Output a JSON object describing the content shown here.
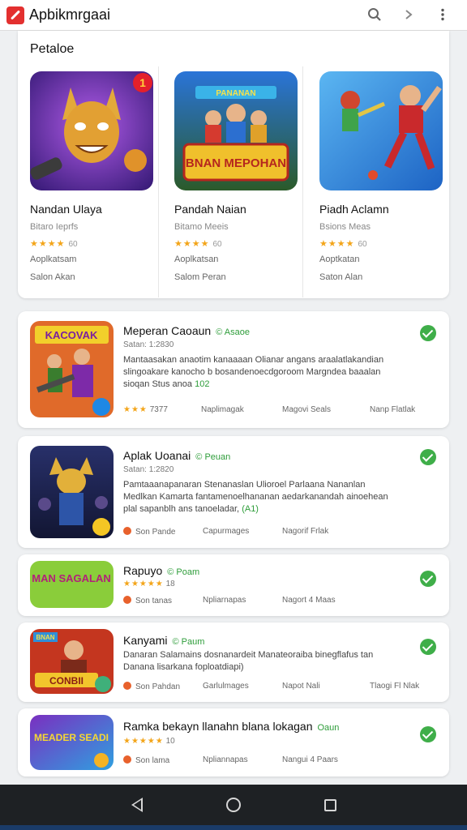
{
  "app": {
    "title": "Apbikmrgaai",
    "accent": "#e3302f",
    "icons": [
      "search-icon",
      "chevron-right-icon",
      "more-vert-icon"
    ]
  },
  "featured": {
    "title": "Petaloe",
    "cards": [
      {
        "name": "Nandan Ulaya",
        "subtitle": "Bitaro Ieprfs",
        "stars": "★★★★",
        "rating": "60",
        "meta1": "Aoplkatsam",
        "meta2": "Salon Akan",
        "badge": "1"
      },
      {
        "name": "Pandah Naian",
        "subtitle": "Bitamo Meeis",
        "stars": "★★★★",
        "rating": "60",
        "meta1": "Aoplkatsan",
        "meta2": "Salom Peran",
        "banner": "BNAN MEPOHAN",
        "topline": "PANANAN"
      },
      {
        "name": "Piadh Aclamn",
        "subtitle": "Bsions Meas",
        "stars": "★★★★",
        "rating": "60",
        "meta1": "Aoptkatan",
        "meta2": "Saton Alan"
      }
    ]
  },
  "list": [
    {
      "title": "Meperan Caoaun",
      "tag": "© Asaoe",
      "subtitle": "Satan: 1:2830",
      "desc": "Mantaasakan anaotim kanaaaan Olianar angans araalatlakandian slingoakare kanocho b bosandenoecdgoroom Margndea baaalan sioqan Stus anoa",
      "desc_hl": "102",
      "stars": "★★★",
      "rating": "7377",
      "col2": "Naplimagak",
      "col3": "Magovi Seals",
      "col4": "Nanp Flatlak",
      "art_text": "KACOVAK"
    },
    {
      "title": "Aplak Uoanai",
      "tag": "© Peuan",
      "subtitle": "Satan: 1:2820",
      "desc": "Pamtaaanapanaran Stenanaslan Ulioroel Parlaana Nananlan Medlkan Kamarta fantamenoelhananan aedarkanandah ainoehean plal sapanblh ans tanoeladar,",
      "desc_hl": "(A1)",
      "col1": "Son Pande",
      "col2": "Capurmages",
      "col3": "Nagorif Frlak"
    },
    {
      "title": "Rapuyo",
      "tag": "© Poam",
      "stars": "★★★★★",
      "rating": "18",
      "col1": "Son tanas",
      "col2": "Npliarnapas",
      "col3": "Nagort 4 Maas",
      "art_text": "MAN SAGALAN"
    },
    {
      "title": "Kanyami",
      "tag": "© Paum",
      "desc": "Danaran Salamains dosnanardeit Manateoraiba binegflafus tan Danana lisarkana foploatdiapi)",
      "col1": "Son Pahdan",
      "col2": "Garlulmages",
      "col3": "Napot Nali",
      "col4": "Tlaogi Fl Nlak",
      "art_top": "BNAN",
      "art_text": "CONBII"
    },
    {
      "title": "Ramka bekayn llanahn blana lokagan",
      "tag": "Oaun",
      "stars": "★★★★★",
      "rating": "10",
      "col1": "Son lama",
      "col2": "Npliannapas",
      "col3": "Nangui 4 Paars",
      "art_text": "MEADER SEADI"
    }
  ]
}
